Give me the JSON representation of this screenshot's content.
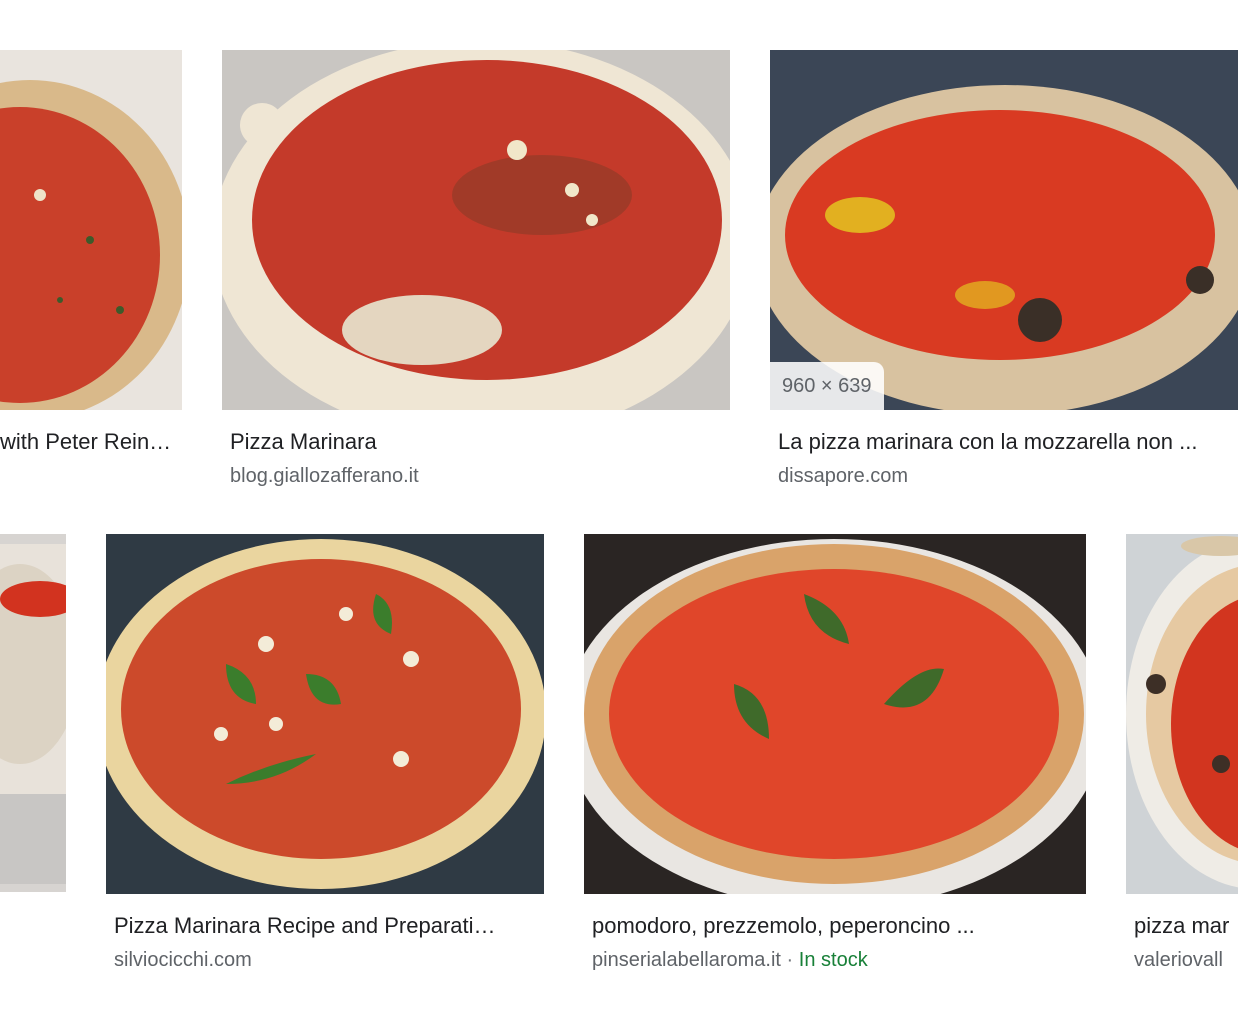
{
  "results": {
    "row1": [
      {
        "title": "with Peter Rein…",
        "source": ""
      },
      {
        "title": "Pizza Marinara",
        "source": "blog.giallozafferano.it"
      },
      {
        "title": "La pizza marinara con la mozzarella non ...",
        "source": "dissapore.com",
        "size_badge": "960 × 639"
      }
    ],
    "row2": [
      {
        "title": "",
        "source": ""
      },
      {
        "title": "Pizza Marinara Recipe and Preparati…",
        "source": "silviocicchi.com"
      },
      {
        "title": "pomodoro, prezzemolo, peperoncino ...",
        "source": "pinserialabellaroma.it",
        "separator": "·",
        "stock": "In stock"
      },
      {
        "title": "pizza mar",
        "source": "valeriovall"
      }
    ]
  },
  "colors": {
    "title": "#202124",
    "source": "#5f6368",
    "in_stock": "#188038"
  }
}
